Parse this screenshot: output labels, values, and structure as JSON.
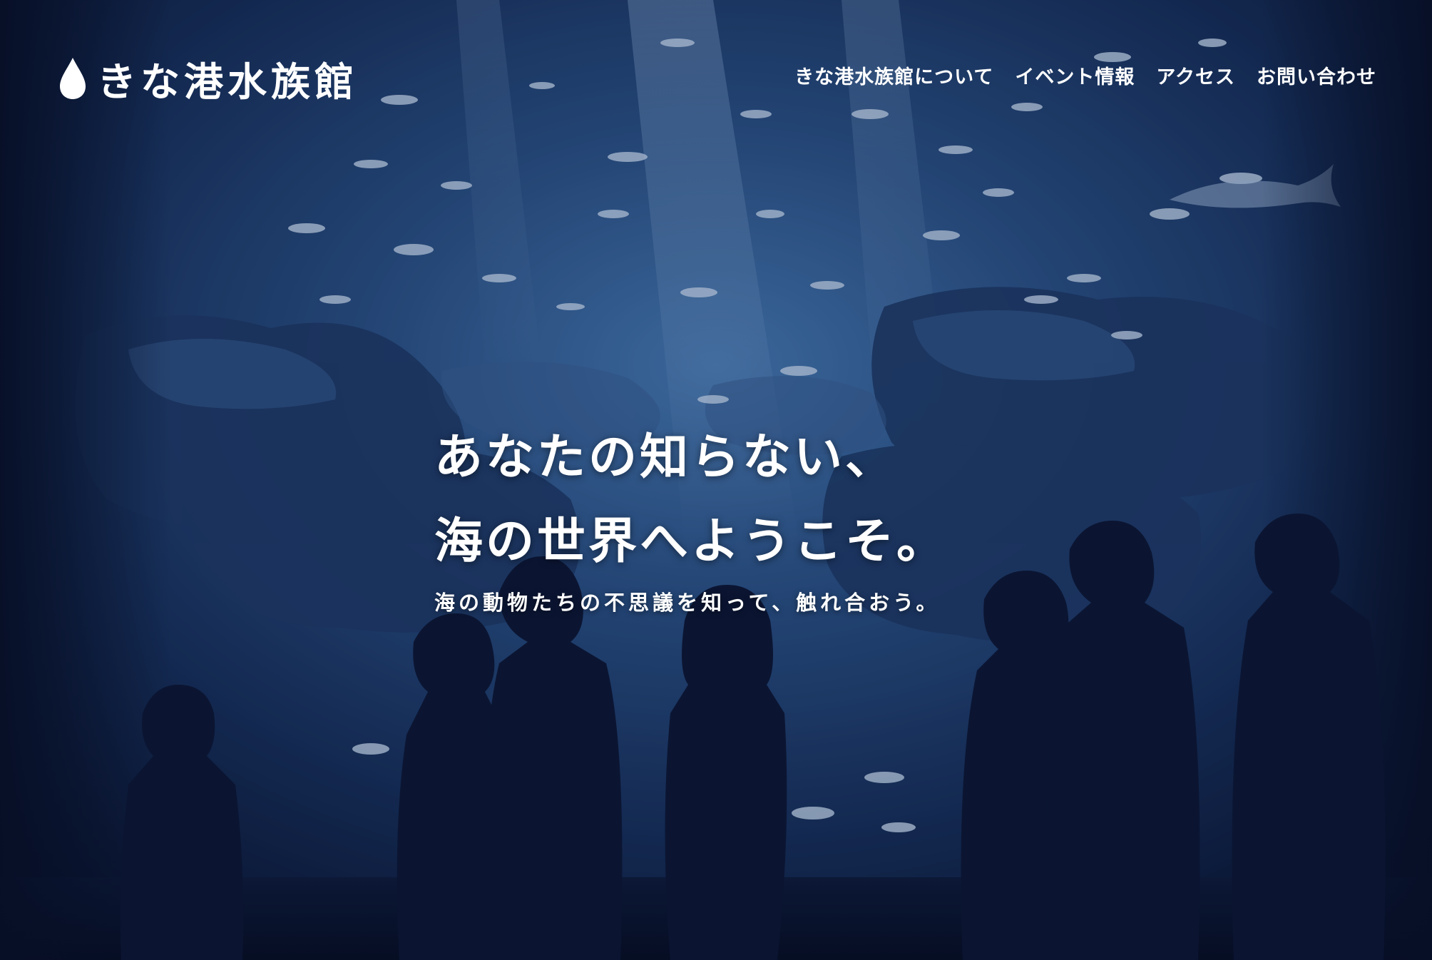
{
  "site": {
    "logo_text": "きな港水族館"
  },
  "nav": {
    "items": [
      {
        "label": "きな港水族館について"
      },
      {
        "label": "イベント情報"
      },
      {
        "label": "アクセス"
      },
      {
        "label": "お問い合わせ"
      }
    ]
  },
  "hero": {
    "headline_line1": "あなたの知らない、",
    "headline_line2": "海の世界へようこそ。",
    "subline": "海の動物たちの不思議を知って、触れ合おう。"
  },
  "colors": {
    "background_dark": "#0b1530",
    "water_blue": "#3c6fa8",
    "text": "#ffffff"
  },
  "icons": {
    "logo_mark": "water-drop-icon"
  }
}
